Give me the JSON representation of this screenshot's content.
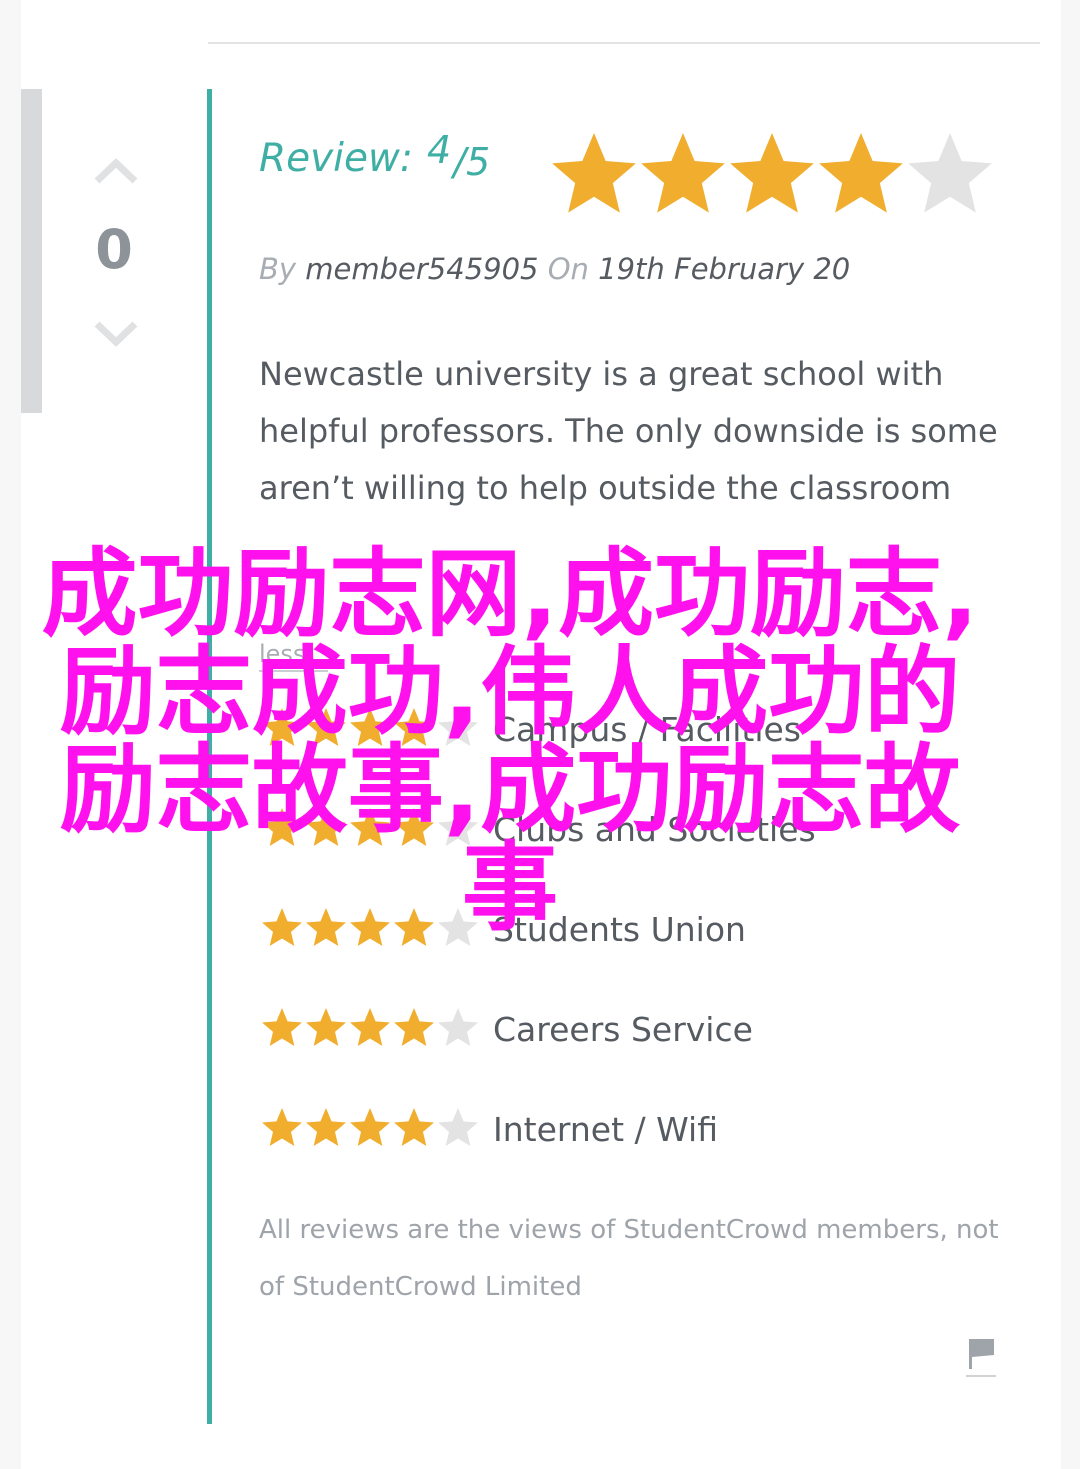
{
  "vote": {
    "count": "0"
  },
  "review": {
    "label": "Review:",
    "score": "4",
    "out_of": "/5",
    "rating": 4,
    "max": 5
  },
  "byline": {
    "by": "By",
    "author": "member545905",
    "on": "On",
    "date": "19th February 20"
  },
  "body": "Newcastle university is a great school with helpful professors. The only downside is some aren’t willing to help outside the classroom",
  "less_link": "less...",
  "categories": [
    {
      "label": "Campus / Facilities",
      "rating": 4
    },
    {
      "label": "Clubs and Societies",
      "rating": 4
    },
    {
      "label": "Students Union",
      "rating": 4
    },
    {
      "label": "Careers Service",
      "rating": 4
    },
    {
      "label": "Internet / Wifi",
      "rating": 4
    }
  ],
  "disclaimer": "All reviews are the views of StudentCrowd members, not of StudentCrowd Limited",
  "overlay_text": "成功励志网,成功励志,励志成功,伟人成功的励志故事,成功励志故事",
  "colors": {
    "accent": "#3fafa5",
    "star_on": "#f0ad2e",
    "star_off": "#e3e3e3",
    "overlay": "#ff11ee"
  },
  "icons": {
    "vote_up": "chevron-up-icon",
    "vote_down": "chevron-down-icon",
    "flag": "flag-icon",
    "star": "star-icon"
  }
}
